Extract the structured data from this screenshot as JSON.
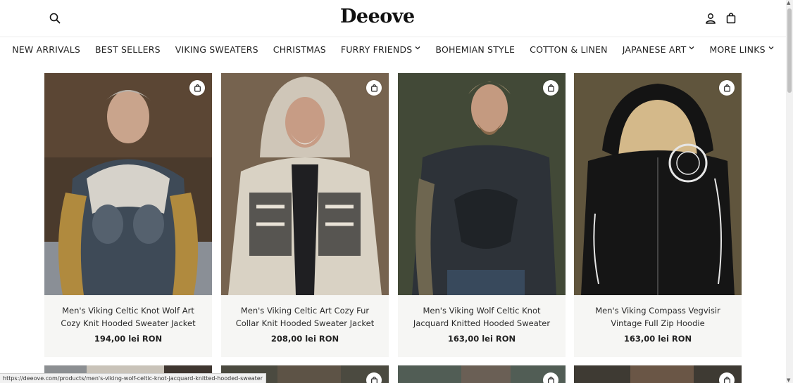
{
  "header": {
    "logo": "Deeove",
    "icons": [
      "search-icon",
      "account-icon",
      "cart-icon"
    ]
  },
  "nav": {
    "items": [
      {
        "label": "NEW ARRIVALS",
        "dropdown": false
      },
      {
        "label": "BEST SELLERS",
        "dropdown": false
      },
      {
        "label": "VIKING SWEATERS",
        "dropdown": false
      },
      {
        "label": "CHRISTMAS",
        "dropdown": false
      },
      {
        "label": "FURRY FRIENDS",
        "dropdown": true
      },
      {
        "label": "BOHEMIAN STYLE",
        "dropdown": false
      },
      {
        "label": "COTTON & LINEN",
        "dropdown": false
      },
      {
        "label": "JAPANESE ART",
        "dropdown": true
      },
      {
        "label": "MORE LINKS",
        "dropdown": true
      }
    ]
  },
  "products": [
    {
      "title": "Men's Viking Celtic Knot Wolf Art Cozy Knit Hooded Sweater Jacket",
      "price": "194,00 lei RON"
    },
    {
      "title": "Men's Viking Celtic Art Cozy Fur Collar Knit Hooded Sweater Jacket",
      "price": "208,00 lei RON"
    },
    {
      "title": "Men's Viking Wolf Celtic Knot Jacquard Knitted Hooded Sweater",
      "price": "163,00 lei RON"
    },
    {
      "title": "Men's Viking Compass Vegvisir Vintage Full Zip Hoodie",
      "price": "163,00 lei RON"
    }
  ],
  "status_bar": {
    "url": "https://deeove.com/products/men's-viking-wolf-celtic-knot-jacquard-knitted-hooded-sweater"
  },
  "colors": {
    "card_bg": "#f6f6f4",
    "text": "#1a1a1a"
  }
}
